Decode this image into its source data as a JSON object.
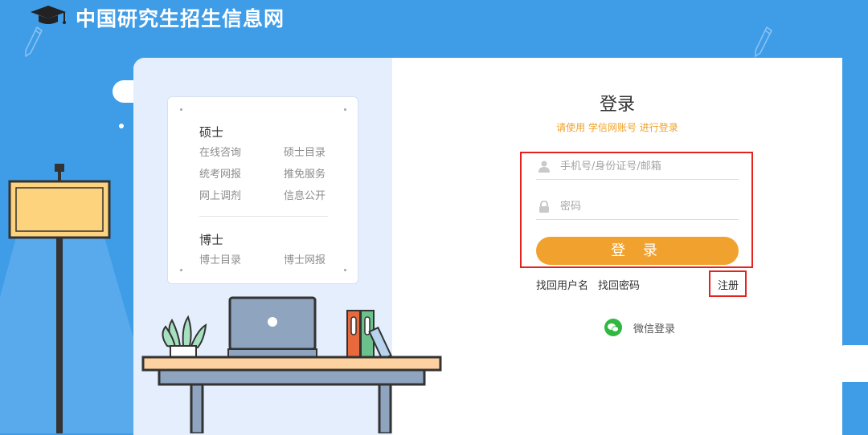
{
  "header": {
    "title": "中国研究生招生信息网"
  },
  "panel": {
    "master": {
      "title": "硕士",
      "links": [
        "在线咨询",
        "硕士目录",
        "统考网报",
        "推免服务",
        "网上调剂",
        "信息公开"
      ]
    },
    "doctor": {
      "title": "博士",
      "links": [
        "博士目录",
        "博士网报"
      ]
    }
  },
  "login": {
    "title": "登录",
    "subtitle": "请使用 学信网账号 进行登录",
    "username_placeholder": "手机号/身份证号/邮箱",
    "password_placeholder": "密码",
    "submit": "登 录",
    "find_username": "找回用户名",
    "find_password": "找回密码",
    "register": "注册",
    "wechat_login": "微信登录"
  },
  "colors": {
    "background": "#3f9de8",
    "accent": "#f1a22e",
    "highlight_box": "#e4231e"
  }
}
